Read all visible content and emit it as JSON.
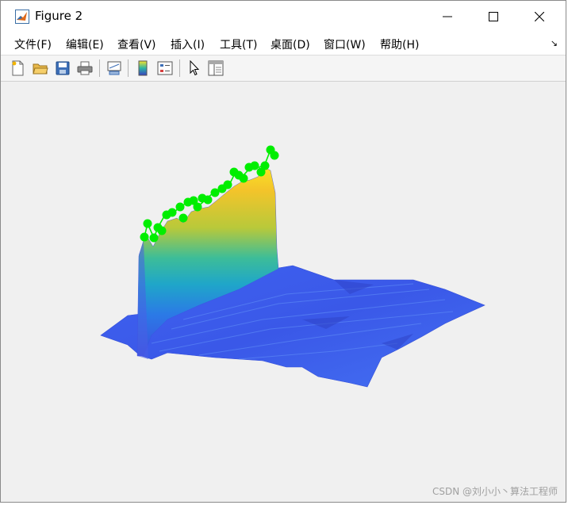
{
  "window": {
    "title": "Figure 2"
  },
  "menu": [
    {
      "label": "文件(F)"
    },
    {
      "label": "编辑(E)"
    },
    {
      "label": "查看(V)"
    },
    {
      "label": "插入(I)"
    },
    {
      "label": "工具(T)"
    },
    {
      "label": "桌面(D)"
    },
    {
      "label": "窗口(W)"
    },
    {
      "label": "帮助(H)"
    }
  ],
  "toolbar": {
    "icons": [
      "new-figure-icon",
      "open-file-icon",
      "save-icon",
      "print-icon",
      "link-plot-icon",
      "insert-colorbar-icon",
      "insert-legend-icon",
      "edit-plot-icon",
      "property-inspector-icon"
    ]
  },
  "plot": {
    "type": "surface-3d",
    "colormap": "parula",
    "marker_color": "#00ee00"
  },
  "watermark": "CSDN @刘小小丶算法工程师"
}
